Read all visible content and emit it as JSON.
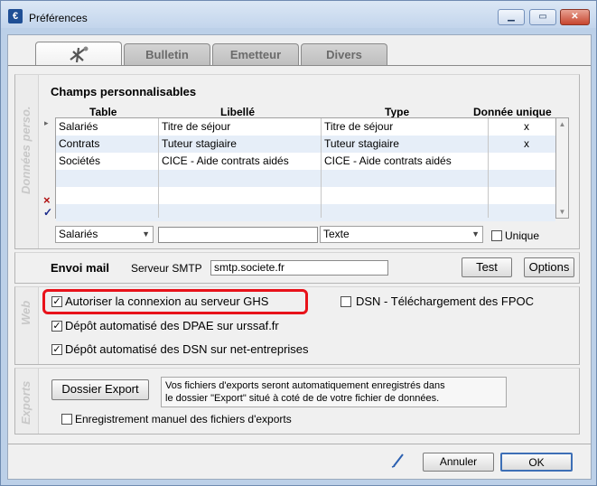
{
  "window": {
    "title": "Préférences",
    "app_icon": "€",
    "minimize": "minimize-icon",
    "maximize": "maximize-icon",
    "close": "close-icon"
  },
  "tabs": [
    {
      "label": "",
      "icon": "settings-tab-icon",
      "active": true
    },
    {
      "label": "Bulletin"
    },
    {
      "label": "Emetteur"
    },
    {
      "label": "Divers"
    }
  ],
  "donnees": {
    "side_label": "Données perso.",
    "heading": "Champs personnalisables",
    "columns": [
      "Table",
      "Libellé",
      "Type",
      "Donnée unique"
    ],
    "rows": [
      {
        "table": "Salariés",
        "libelle": "Titre de séjour",
        "type": "Titre de séjour",
        "unique": "x"
      },
      {
        "table": "Contrats",
        "libelle": "Tuteur stagiaire",
        "type": "Tuteur stagiaire",
        "unique": "x"
      },
      {
        "table": "Sociétés",
        "libelle": "CICE - Aide contrats aidés",
        "type": "CICE - Aide contrats aidés",
        "unique": ""
      }
    ],
    "table_combo": "Salariés",
    "libelle_input": "",
    "type_combo": "Texte",
    "unique_label": "Unique",
    "delete_mark": "×",
    "validate_mark": "✓"
  },
  "mail": {
    "heading": "Envoi mail",
    "smtp_label": "Serveur SMTP",
    "smtp_value": "smtp.societe.fr",
    "test_button": "Test",
    "options_button": "Options"
  },
  "web": {
    "side_label": "Web",
    "ghs_label": "Autoriser la connexion au serveur GHS",
    "ghs_checked": true,
    "dsn_label": "DSN - Téléchargement des FPOC",
    "dsn_checked": false,
    "dpae_label": "Dépôt automatisé des DPAE sur urssaf.fr",
    "dpae_checked": true,
    "dsn_auto_label": "Dépôt automatisé des DSN sur net-entreprises",
    "dsn_auto_checked": true,
    "highlight_color": "#e8121a"
  },
  "exports": {
    "side_label": "Exports",
    "folder_button": "Dossier Export",
    "info_line1": "Vos fichiers d'exports seront automatiquement enregistrés dans",
    "info_line2": "le dossier \"Export\" situé à coté de de votre fichier de données.",
    "manual_label": "Enregistrement manuel des fichiers d'exports",
    "manual_checked": false
  },
  "footer": {
    "cancel": "Annuler",
    "ok": "OK",
    "edit_icon": "pencil-icon"
  }
}
